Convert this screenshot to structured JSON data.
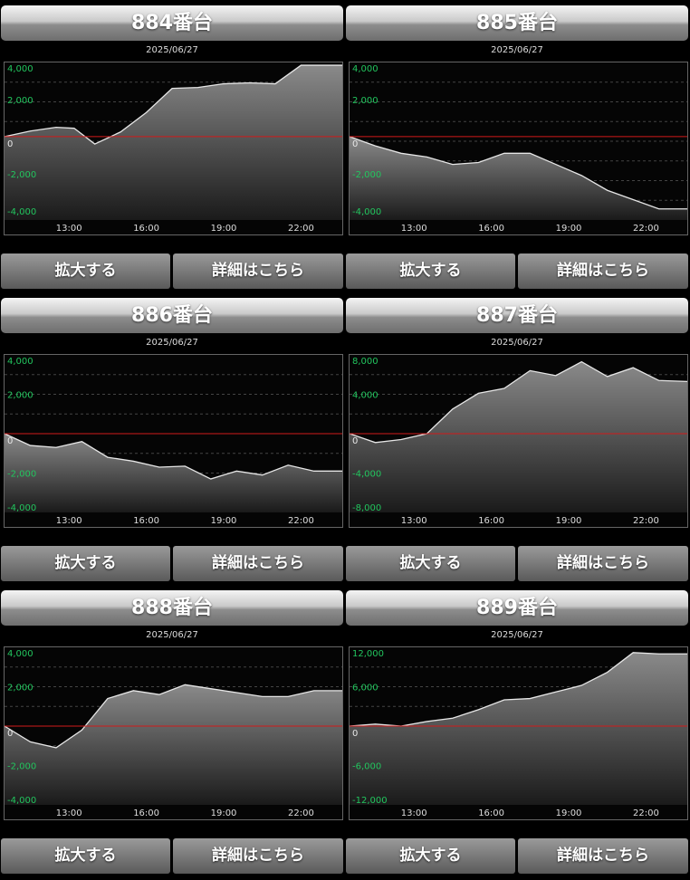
{
  "buttons": {
    "zoom_label": "拡大する",
    "detail_label": "詳細はこちら"
  },
  "colors": {
    "line": "#e6e6e6",
    "zero_line": "#d11a1a",
    "ytick": "#22c55e",
    "xtick": "#dddddd"
  },
  "chart_data": [
    {
      "type": "area",
      "title": "884番台",
      "date": "2025/06/27",
      "xticks": [
        "13:00",
        "16:00",
        "19:00",
        "22:00"
      ],
      "xlim": [
        10.5,
        23.6
      ],
      "ylim": [
        -4500,
        4000
      ],
      "yticks": [
        4000,
        2000,
        0,
        -2000,
        -4000
      ],
      "ytick_labels": [
        "4,000",
        "2,000",
        "0",
        "-2,000",
        "-4,000"
      ],
      "x": [
        10.5,
        11.5,
        12.5,
        13.2,
        14,
        15,
        16,
        17,
        18,
        19,
        20,
        21,
        22,
        23.6
      ],
      "y": [
        0,
        300,
        500,
        450,
        -400,
        250,
        1300,
        2600,
        2650,
        2850,
        2900,
        2850,
        3850,
        3850
      ]
    },
    {
      "type": "area",
      "title": "885番台",
      "date": "2025/06/27",
      "xticks": [
        "13:00",
        "16:00",
        "19:00",
        "22:00"
      ],
      "xlim": [
        10.5,
        23.6
      ],
      "ylim": [
        -4500,
        4000
      ],
      "yticks": [
        4000,
        2000,
        0,
        -2000,
        -4000
      ],
      "ytick_labels": [
        "4,000",
        "2,000",
        "0",
        "-2,000",
        "-4,000"
      ],
      "x": [
        10.5,
        11.5,
        12.5,
        13.5,
        14.5,
        15.5,
        16.5,
        17.5,
        18.5,
        19.5,
        20.5,
        21.5,
        22.5,
        23.6
      ],
      "y": [
        0,
        -500,
        -900,
        -1100,
        -1500,
        -1400,
        -900,
        -900,
        -1500,
        -2100,
        -2900,
        -3400,
        -3900,
        -3900
      ]
    },
    {
      "type": "area",
      "title": "886番台",
      "date": "2025/06/27",
      "xticks": [
        "13:00",
        "16:00",
        "19:00",
        "22:00"
      ],
      "xlim": [
        10.5,
        23.6
      ],
      "ylim": [
        -4000,
        4000
      ],
      "yticks": [
        4000,
        2000,
        0,
        -2000,
        -4000
      ],
      "ytick_labels": [
        "4,000",
        "2,000",
        "0",
        "-2,000",
        "-4,000"
      ],
      "x": [
        10.5,
        11.5,
        12.5,
        13.5,
        14.5,
        15.5,
        16.5,
        17.5,
        18.5,
        19.5,
        20.5,
        21.5,
        22.5,
        23.6
      ],
      "y": [
        0,
        -600,
        -700,
        -400,
        -1200,
        -1400,
        -1700,
        -1650,
        -2300,
        -1900,
        -2100,
        -1600,
        -1900,
        -1900
      ]
    },
    {
      "type": "area",
      "title": "887番台",
      "date": "2025/06/27",
      "xticks": [
        "13:00",
        "16:00",
        "19:00",
        "22:00"
      ],
      "xlim": [
        10.5,
        23.6
      ],
      "ylim": [
        -8000,
        8000
      ],
      "yticks": [
        8000,
        4000,
        0,
        -4000,
        -8000
      ],
      "ytick_labels": [
        "8,000",
        "4,000",
        "0",
        "-4,000",
        "-8,000"
      ],
      "x": [
        10.5,
        11.5,
        12.5,
        13.5,
        14.5,
        15.5,
        16.5,
        17.5,
        18.5,
        19.5,
        20.5,
        21.5,
        22.5,
        23.6
      ],
      "y": [
        0,
        -900,
        -600,
        0,
        2500,
        4100,
        4600,
        6400,
        5900,
        7300,
        5800,
        6700,
        5400,
        5300
      ]
    },
    {
      "type": "area",
      "title": "888番台",
      "date": "2025/06/27",
      "xticks": [
        "13:00",
        "16:00",
        "19:00",
        "22:00"
      ],
      "xlim": [
        10.5,
        23.6
      ],
      "ylim": [
        -4000,
        4000
      ],
      "yticks": [
        4000,
        2000,
        0,
        -2000,
        -4000
      ],
      "ytick_labels": [
        "4,000",
        "2,000",
        "0",
        "-2,000",
        "-4,000"
      ],
      "x": [
        10.5,
        11.5,
        12.5,
        13.5,
        14.5,
        15.5,
        16.5,
        17.5,
        18.5,
        19.5,
        20.5,
        21.5,
        22.5,
        23.6
      ],
      "y": [
        0,
        -800,
        -1100,
        -200,
        1400,
        1800,
        1600,
        2100,
        1900,
        1700,
        1500,
        1500,
        1800,
        1800
      ]
    },
    {
      "type": "area",
      "title": "889番台",
      "date": "2025/06/27",
      "xticks": [
        "13:00",
        "16:00",
        "19:00",
        "22:00"
      ],
      "xlim": [
        10.5,
        23.6
      ],
      "ylim": [
        -12000,
        12000
      ],
      "yticks": [
        12000,
        6000,
        0,
        -6000,
        -12000
      ],
      "ytick_labels": [
        "12,000",
        "6,000",
        "0",
        "-6,000",
        "-12,000"
      ],
      "x": [
        10.5,
        11.5,
        12.5,
        13.5,
        14.5,
        15.5,
        16.5,
        17.5,
        18.5,
        19.5,
        20.5,
        21.5,
        22.5,
        23.6
      ],
      "y": [
        0,
        300,
        0,
        700,
        1200,
        2500,
        4000,
        4200,
        5200,
        6200,
        8200,
        11200,
        11000,
        11000
      ]
    }
  ]
}
